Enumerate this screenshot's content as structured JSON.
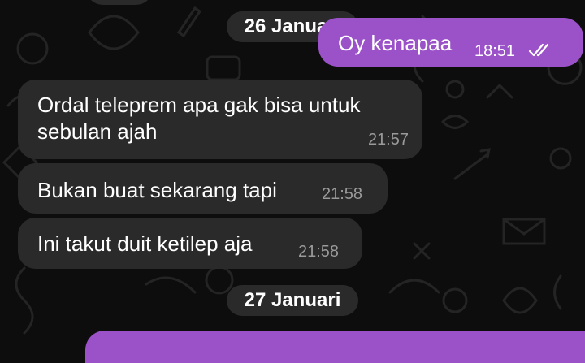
{
  "date_separators": [
    "26 Januari",
    "27 Januari"
  ],
  "messages": [
    {
      "direction": "outgoing",
      "text": "Oy kenapaa",
      "time": "18:51",
      "status_icon": "double-check-icon"
    },
    {
      "direction": "incoming",
      "lines": [
        "Ordal teleprem apa gak bisa untuk",
        "sebulan ajah"
      ],
      "time": "21:57"
    },
    {
      "direction": "incoming",
      "text": "Bukan buat sekarang tapi",
      "time": "21:58"
    },
    {
      "direction": "incoming",
      "text": "Ini takut duit ketilep aja",
      "time": "21:58"
    }
  ],
  "colors": {
    "background": "#0d0d0d",
    "incoming_bubble": "#2a2a2a",
    "outgoing_bubble": "#9b52c9",
    "timestamp_incoming": "#9a9a9a"
  }
}
